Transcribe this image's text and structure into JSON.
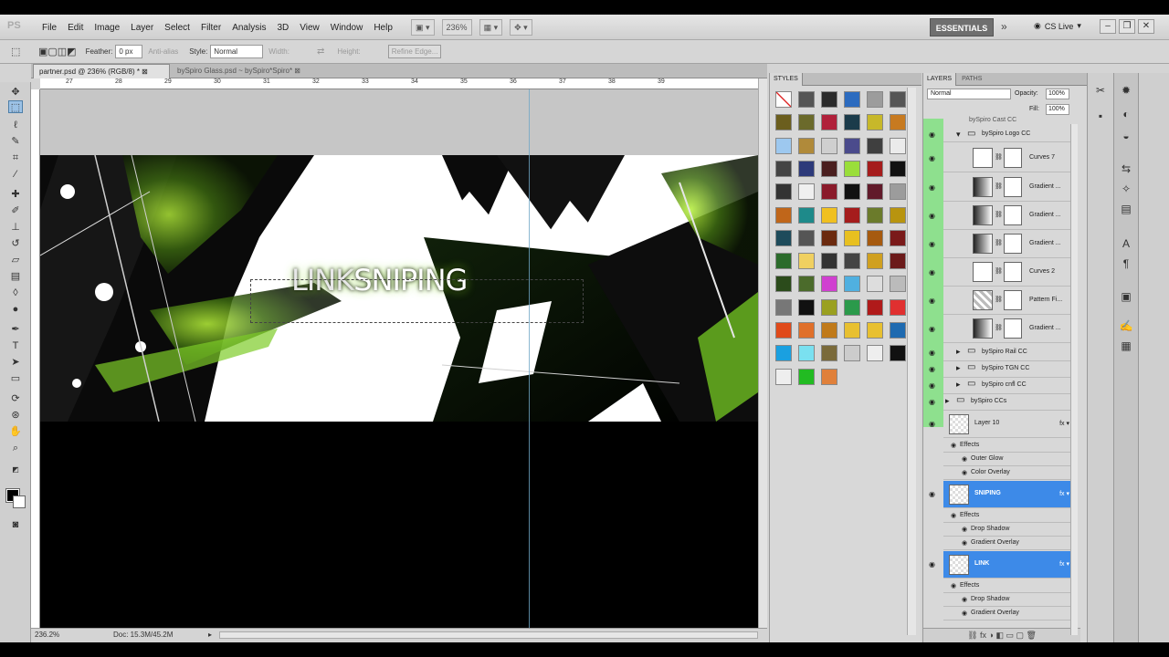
{
  "menubar": {
    "logo": "PS",
    "items": [
      "File",
      "Edit",
      "Image",
      "Layer",
      "Select",
      "Filter",
      "Analysis",
      "3D",
      "View",
      "Window",
      "Help"
    ],
    "zoom": "236%",
    "workspace": "ESSENTIALS",
    "cslive": "CS Live"
  },
  "options": {
    "feather_label": "Feather:",
    "feather_value": "0 px",
    "antialias": "Anti-alias",
    "style_label": "Style:",
    "style_value": "Normal",
    "width_label": "Width:",
    "height_label": "Height:",
    "refine": "Refine Edge..."
  },
  "document": {
    "tab_active": "partner.psd @ 236% (RGB/8) * ⊠",
    "tab_inactive": "bySpiro Glass.psd ~ bySpiro*Spiro* ⊠",
    "ruler_marks": [
      "27",
      "28",
      "29",
      "30",
      "31",
      "32",
      "33",
      "34",
      "35",
      "36",
      "37",
      "38",
      "39"
    ],
    "banner_text_a": "LINK",
    "banner_text_b": "SNIPING",
    "zoom_status": "236.2%",
    "doc_status": "Doc: 15.3M/45.2M"
  },
  "styles_panel": {
    "title": "STYLES",
    "swatches": [
      "#ffffff",
      "#555555",
      "#2b2b2b",
      "#2c6bbf",
      "#9c9c9c",
      "#555555",
      "#6b5e1e",
      "#6b6a2b",
      "#b0203a",
      "#1b3b4a",
      "#c7b82a",
      "#c77a20",
      "#9dc8ef",
      "#b08a3a",
      "#cfcfcf",
      "#4b4b8c",
      "#3f3f3f",
      "#ebebeb",
      "#444444",
      "#2d3a7a",
      "#4a1f1f",
      "#9ade3a",
      "#a51c1c",
      "#111111",
      "#333333",
      "#efefef",
      "#8a1a2a",
      "#111111",
      "#611a2a",
      "#9c9c9c",
      "#c0661a",
      "#1e8a8a",
      "#f0c020",
      "#a51c1c",
      "#6b7b2b",
      "#b8940f",
      "#1e4b5b",
      "#555555",
      "#6b2a0f",
      "#e8c020",
      "#a65a0f",
      "#7a1a1a",
      "#2b6b2b",
      "#f0d060",
      "#333333",
      "#444444",
      "#d0a020",
      "#6b1a1a",
      "#2b4b1b",
      "#4b6b2b",
      "#d040d0",
      "#50b0e0",
      "#dddddd",
      "#bbbbbb",
      "#777777",
      "#111111",
      "#9aa020",
      "#2b9a4b",
      "#b01a1a",
      "#e03030",
      "#e04a1a",
      "#e0702a",
      "#c07a1a",
      "#e8c030",
      "#e8c030",
      "#1e6ab0",
      "#1aa0e0",
      "#7ae0f0",
      "#7a6a3a",
      "#cccccc",
      "#eeeeee",
      "#111111",
      "#eeeeee",
      "#22bb22",
      "#e0803a"
    ]
  },
  "layers_panel": {
    "tab_layers": "LAYERS",
    "tab_paths": "PATHS",
    "blend_mode": "Normal",
    "opacity_label": "Opacity:",
    "opacity_value": "100%",
    "fill_label": "Fill:",
    "fill_value": "100%",
    "rows": [
      {
        "name": "bySpiro Logo CC",
        "type": "group"
      },
      {
        "name": "Curves 7",
        "type": "adj"
      },
      {
        "name": "Gradient ...",
        "type": "adj"
      },
      {
        "name": "Gradient ...",
        "type": "adj"
      },
      {
        "name": "Gradient ...",
        "type": "adj"
      },
      {
        "name": "Curves 2",
        "type": "adj"
      },
      {
        "name": "Pattern Fi...",
        "type": "adj"
      },
      {
        "name": "Gradient ...",
        "type": "adj"
      },
      {
        "name": "bySpiro Rail CC",
        "type": "group"
      },
      {
        "name": "bySpiro TGN CC",
        "type": "group"
      },
      {
        "name": "bySpiro cnfl CC",
        "type": "group"
      },
      {
        "name": "bySpiro CCs",
        "type": "group"
      },
      {
        "name": "Layer 10",
        "type": "layer"
      },
      {
        "name": "Effects",
        "type": "fx"
      },
      {
        "name": "Outer Glow",
        "type": "fx"
      },
      {
        "name": "Color Overlay",
        "type": "fx"
      },
      {
        "name": "SNIPING",
        "type": "text"
      },
      {
        "name": "Effects",
        "type": "fx"
      },
      {
        "name": "Drop Shadow",
        "type": "fx"
      },
      {
        "name": "Gradient Overlay",
        "type": "fx"
      },
      {
        "name": "LINK",
        "type": "text"
      },
      {
        "name": "Effects",
        "type": "fx"
      },
      {
        "name": "Drop Shadow",
        "type": "fx"
      },
      {
        "name": "Gradient Overlay",
        "type": "fx"
      }
    ],
    "top_partial": "bySpiro Cast CC"
  },
  "colors": {
    "accent": "#3d8ae8",
    "green": "#8ee08e",
    "glow": "#8cdc28"
  }
}
